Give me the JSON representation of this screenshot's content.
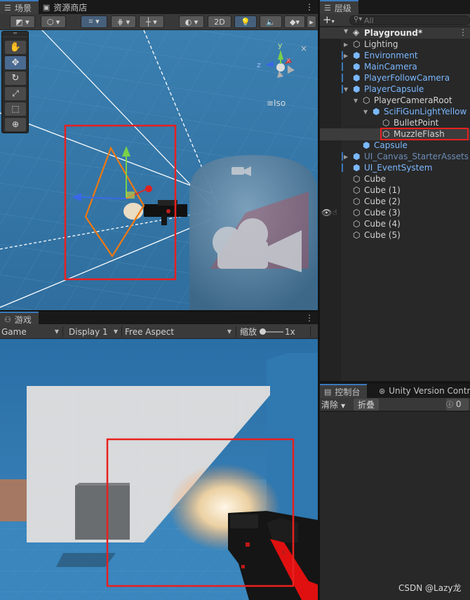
{
  "scene_tab": {
    "label": "场景",
    "icon": "scene-icon"
  },
  "asset_store_tab": {
    "label": "资源商店",
    "icon": "asset-store-icon"
  },
  "scene_toolbar": {
    "toggle_2d": "2D"
  },
  "gizmo": {
    "view_label": "≡Iso",
    "axis_x": "x",
    "axis_y": "y",
    "axis_z": "z"
  },
  "hierarchy": {
    "tab_label": "层级",
    "add_label": "+",
    "search_placeholder": "All",
    "scene_name": "Playground*",
    "items": [
      {
        "label": "Lighting",
        "depth": 1,
        "arrow": "▶",
        "style": "white"
      },
      {
        "label": "Environment",
        "depth": 1,
        "arrow": "▶",
        "style": "blue"
      },
      {
        "label": "MainCamera",
        "depth": 1,
        "arrow": "",
        "style": "blue"
      },
      {
        "label": "PlayerFollowCamera",
        "depth": 1,
        "arrow": "",
        "style": "blue"
      },
      {
        "label": "PlayerCapsule",
        "depth": 1,
        "arrow": "▼",
        "style": "blue"
      },
      {
        "label": "PlayerCameraRoot",
        "depth": 2,
        "arrow": "▼",
        "style": "white"
      },
      {
        "label": "SciFiGunLightYellow",
        "depth": 3,
        "arrow": "▼",
        "style": "blue"
      },
      {
        "label": "BulletPoint",
        "depth": 4,
        "arrow": "",
        "style": "white"
      },
      {
        "label": "MuzzleFlash",
        "depth": 4,
        "arrow": "",
        "style": "white"
      },
      {
        "label": "Capsule",
        "depth": 2,
        "arrow": "",
        "style": "blue"
      },
      {
        "label": "UI_Canvas_StarterAssets",
        "depth": 1,
        "arrow": "▶",
        "style": "dim"
      },
      {
        "label": "UI_EventSystem",
        "depth": 1,
        "arrow": "",
        "style": "blue"
      },
      {
        "label": "Cube",
        "depth": 1,
        "arrow": "",
        "style": "white"
      },
      {
        "label": "Cube (1)",
        "depth": 1,
        "arrow": "",
        "style": "white"
      },
      {
        "label": "Cube (2)",
        "depth": 1,
        "arrow": "",
        "style": "white"
      },
      {
        "label": "Cube (3)",
        "depth": 1,
        "arrow": "",
        "style": "white"
      },
      {
        "label": "Cube (4)",
        "depth": 1,
        "arrow": "",
        "style": "white"
      },
      {
        "label": "Cube (5)",
        "depth": 1,
        "arrow": "",
        "style": "white"
      }
    ]
  },
  "game": {
    "tab_label": "游戏",
    "game_dropdown": "Game",
    "display_dropdown": "Display 1",
    "aspect_dropdown": "Free Aspect",
    "scale_label": "缩放",
    "scale_value": "1x"
  },
  "console": {
    "tab_label": "控制台",
    "unity_vc_tab": "Unity Version Control",
    "clear_label": "清除",
    "collapse_label": "折叠",
    "count": "0"
  },
  "watermark": "CSDN @Lazy龙",
  "colors": {
    "selection_box": "#e8201f",
    "accent": "#3a79bb",
    "hier_blue": "#7bb8ff"
  }
}
